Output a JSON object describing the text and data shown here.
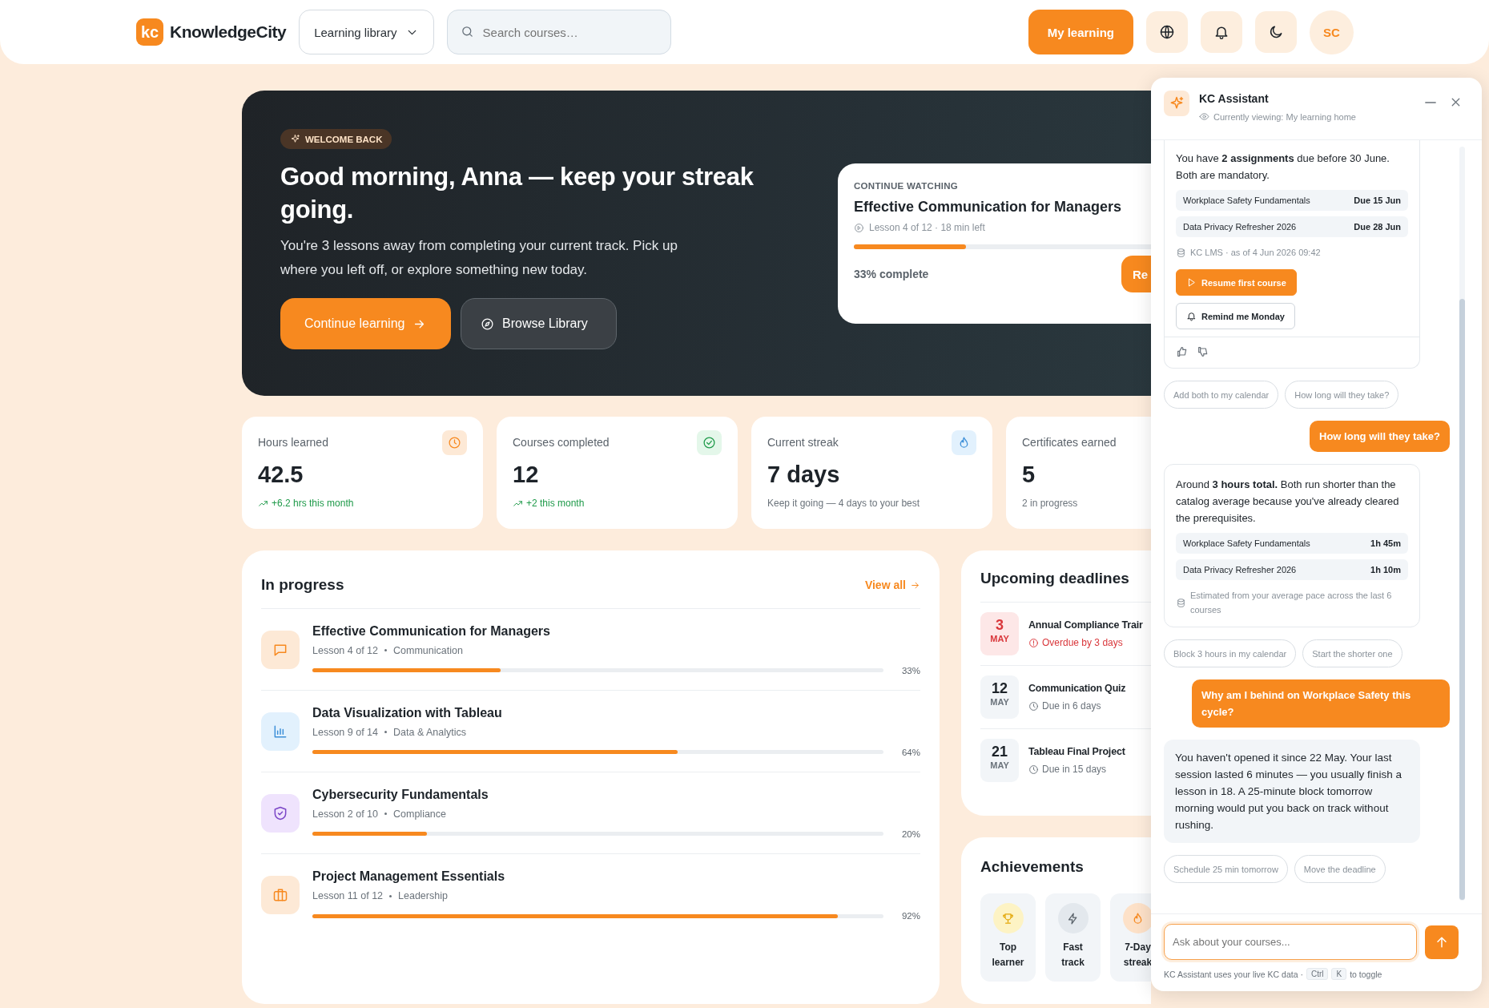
{
  "header": {
    "logo_mark": "kc",
    "brand": "KnowledgeCity",
    "library_menu": "Learning library",
    "search": {
      "placeholder": "Search courses…"
    },
    "my_learning": "My learning",
    "avatar": "SC"
  },
  "hero": {
    "badge": "WELCOME BACK",
    "heading": "Good morning, Anna — keep your streak going.",
    "text": "You're 3 lessons away from completing your current track. Pick up where you left off, or explore something new today.",
    "buttons": [
      {
        "label": "Continue learning",
        "kind": "primary"
      },
      {
        "label": "Browse Library",
        "kind": "secondary"
      }
    ],
    "continue_card": {
      "eyebrow": "CONTINUE WATCHING",
      "title": "Effective Communication for Managers",
      "meta": "Lesson 4 of 12 · 18 min left",
      "level": 0.33,
      "progress_text": "33% complete",
      "button": "Re"
    }
  },
  "stats": [
    {
      "label": "Hours learned",
      "value": "42.5",
      "note": "+6.2 hrs this month",
      "trend": true,
      "kind": "hours"
    },
    {
      "label": "Courses completed",
      "value": "12",
      "note": "+2 this month",
      "trend": true,
      "kind": "courses"
    },
    {
      "label": "Current streak",
      "value": "7 days",
      "note": "Keep it going — 4 days to your best",
      "trend": false,
      "kind": "streak"
    },
    {
      "label": "Certificates earned",
      "value": "5",
      "note": "2 in progress",
      "trend": false,
      "kind": "certificates"
    }
  ],
  "in_progress": {
    "title": "In progress",
    "view_all": "View all",
    "courses": [
      {
        "title": "Effective Communication for Managers",
        "lesson": "Lesson 4 of 12",
        "category": "Communication",
        "level": 0.33,
        "percent": "33%",
        "kind": "chat"
      },
      {
        "title": "Data Visualization with Tableau",
        "lesson": "Lesson 9 of 14",
        "category": "Data & Analytics",
        "level": 0.64,
        "percent": "64%",
        "kind": "chart"
      },
      {
        "title": "Cybersecurity Fundamentals",
        "lesson": "Lesson 2 of 10",
        "category": "Compliance",
        "level": 0.2,
        "percent": "20%",
        "kind": "shield"
      },
      {
        "title": "Project Management Essentials",
        "lesson": "Lesson 11 of 12",
        "category": "Leadership",
        "level": 0.92,
        "percent": "92%",
        "kind": "briefcase"
      }
    ]
  },
  "deadlines": {
    "title": "Upcoming deadlines",
    "items": [
      {
        "day": "3",
        "month": "MAY",
        "title": "Annual Compliance Trair",
        "status": "Overdue by 3 days",
        "overdue": true
      },
      {
        "day": "12",
        "month": "MAY",
        "title": "Communication Quiz",
        "status": "Due in 6 days",
        "overdue": false
      },
      {
        "day": "21",
        "month": "MAY",
        "title": "Tableau Final Project",
        "status": "Due in 15 days",
        "overdue": false
      }
    ]
  },
  "achievements": {
    "title": "Achievements",
    "items": [
      {
        "label": "Top learner",
        "kind": "trophy"
      },
      {
        "label": "Fast track",
        "kind": "bolt"
      },
      {
        "label": "7-Day streak",
        "kind": "flame"
      }
    ]
  },
  "assistant": {
    "title": "KC Assistant",
    "context": "Currently viewing: My learning home",
    "messages": [
      {
        "kind": "answer",
        "text": "You have **2 assignments** due before 30 June. Both are mandatory.",
        "rows": [
          {
            "name": "Workplace Safety Fundamentals",
            "value": "Due 15 Jun"
          },
          {
            "name": "Data Privacy Refresher 2026",
            "value": "Due 28 Jun"
          }
        ],
        "source": "KC LMS · as of 4 Jun 2026 09:42",
        "actions": [
          {
            "label": "Resume first course",
            "kind": "primary"
          },
          {
            "label": "Remind me Monday",
            "kind": "secondary"
          }
        ],
        "feedback": true
      },
      {
        "kind": "chips",
        "chips": [
          "Add both to my calendar",
          "How long will they take?"
        ]
      },
      {
        "kind": "user",
        "text": "How long will they take?"
      },
      {
        "kind": "answer",
        "text": "Around **3 hours total.** Both run shorter than the catalog average because you've already cleared the prerequisites.",
        "rows": [
          {
            "name": "Workplace Safety Fundamentals",
            "value": "1h 45m"
          },
          {
            "name": "Data Privacy Refresher 2026",
            "value": "1h 10m"
          }
        ],
        "source": "Estimated from your average pace across the last 6 courses",
        "feedback": false
      },
      {
        "kind": "chips",
        "chips": [
          "Block 3 hours in my calendar",
          "Start the shorter one"
        ]
      },
      {
        "kind": "user",
        "text": "Why am I behind on Workplace Safety this cycle?"
      },
      {
        "kind": "reply",
        "text": "You haven't opened it since 22 May. Your last session lasted 6 minutes — you usually finish a lesson in 18. A 25-minute block tomorrow morning would put you back on track without rushing."
      },
      {
        "kind": "chips",
        "chips": [
          "Schedule 25 min tomorrow",
          "Move the deadline"
        ]
      }
    ],
    "input": {
      "placeholder": "Ask about your courses..."
    },
    "footer": {
      "text": "KC Assistant uses your live KC data ·",
      "keys": [
        "Ctrl",
        "K"
      ],
      "suffix": "to toggle"
    }
  }
}
